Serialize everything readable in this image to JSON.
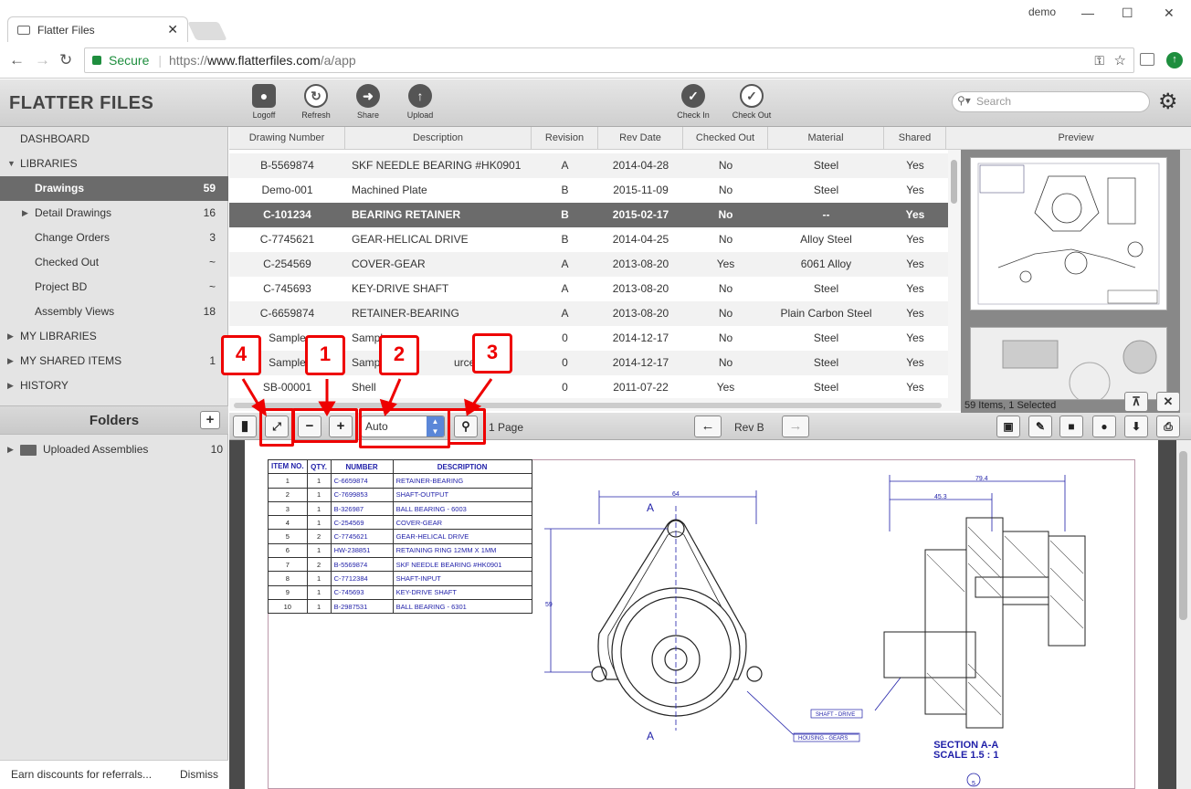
{
  "browser": {
    "tab_title": "Flatter Files",
    "tab_close": "✕",
    "user": "demo",
    "secure_label": "Secure",
    "url_prefix": "https://",
    "url_host": "www.flatterfiles.com",
    "url_path": "/a/app"
  },
  "app": {
    "brand": "FLATTER FILES",
    "toolbar": [
      {
        "label": "Logoff",
        "icon": "lock-icon"
      },
      {
        "label": "Refresh",
        "icon": "refresh-icon"
      },
      {
        "label": "Share",
        "icon": "share-arrow-icon"
      },
      {
        "label": "Upload",
        "icon": "upload-arrow-icon"
      },
      {
        "label": "Check In",
        "icon": "check-circle-filled-icon"
      },
      {
        "label": "Check Out",
        "icon": "check-circle-outline-icon"
      }
    ],
    "search_placeholder": "Search"
  },
  "sidebar": {
    "dashboard": "DASHBOARD",
    "libraries": "LIBRARIES",
    "items": [
      {
        "label": "Drawings",
        "count": "59"
      },
      {
        "label": "Detail Drawings",
        "count": "16"
      },
      {
        "label": "Change Orders",
        "count": "3"
      },
      {
        "label": "Checked Out",
        "count": "~"
      },
      {
        "label": "Project BD",
        "count": "~"
      },
      {
        "label": "Assembly Views",
        "count": "18"
      }
    ],
    "my_libraries": "MY LIBRARIES",
    "my_shared": "MY SHARED ITEMS",
    "my_shared_count": "1",
    "history": "HISTORY",
    "folders_title": "Folders",
    "folder_add": "+",
    "folder": "Uploaded Assemblies",
    "folder_count": "10",
    "footer_text": "Earn discounts for referrals...",
    "footer_dismiss": "Dismiss"
  },
  "table": {
    "columns": [
      "Drawing Number",
      "Description",
      "Revision",
      "Rev Date",
      "Checked Out",
      "Material",
      "Shared"
    ],
    "rows": [
      [
        "B-5569874",
        "SKF NEEDLE BEARING #HK0901",
        "A",
        "2014-04-28",
        "No",
        "Steel",
        "Yes"
      ],
      [
        "Demo-001",
        "Machined Plate",
        "B",
        "2015-11-09",
        "No",
        "Steel",
        "Yes"
      ],
      [
        "C-101234",
        "BEARING RETAINER",
        "B",
        "2015-02-17",
        "No",
        "--",
        "Yes"
      ],
      [
        "C-7745621",
        "GEAR-HELICAL DRIVE",
        "B",
        "2014-04-25",
        "No",
        "Alloy Steel",
        "Yes"
      ],
      [
        "C-254569",
        "COVER-GEAR",
        "A",
        "2013-08-20",
        "Yes",
        "6061 Alloy",
        "Yes"
      ],
      [
        "C-745693",
        "KEY-DRIVE SHAFT",
        "A",
        "2013-08-20",
        "No",
        "Steel",
        "Yes"
      ],
      [
        "C-6659874",
        "RETAINER-BEARING",
        "A",
        "2013-08-20",
        "No",
        "Plain Carbon Steel",
        "Yes"
      ],
      [
        "Sample",
        "Sample",
        "0",
        "2014-12-17",
        "No",
        "Steel",
        "Yes"
      ],
      [
        "Sample",
        "Sample",
        "0",
        "2014-12-17",
        "No",
        "Steel",
        "Yes"
      ],
      [
        "SB-00001",
        "Shell",
        "0",
        "2011-07-22",
        "Yes",
        "Steel",
        "Yes"
      ]
    ],
    "row8_desc_tail": "urce File"
  },
  "preview": {
    "title": "Preview",
    "count": "59 Items, 1 Selected"
  },
  "viewer": {
    "zoom": "Auto",
    "pages": "1 Page",
    "revision": "Rev B"
  },
  "annotations": [
    "4",
    "1",
    "2",
    "3"
  ],
  "drawing": {
    "bom_headers": [
      "ITEM NO.",
      "QTY.",
      "NUMBER",
      "DESCRIPTION"
    ],
    "bom": [
      [
        "1",
        "1",
        "C-6659874",
        "RETAINER-BEARING"
      ],
      [
        "2",
        "1",
        "C-7699853",
        "SHAFT-OUTPUT"
      ],
      [
        "3",
        "1",
        "B-326987",
        "BALL BEARING - 6003"
      ],
      [
        "4",
        "1",
        "C-254569",
        "COVER-GEAR"
      ],
      [
        "5",
        "2",
        "C-7745621",
        "GEAR-HELICAL DRIVE"
      ],
      [
        "6",
        "1",
        "HW-238851",
        "RETAINING RING 12MM  X 1MM"
      ],
      [
        "7",
        "2",
        "B-5569874",
        "SKF NEEDLE BEARING #HK0901"
      ],
      [
        "8",
        "1",
        "C-7712384",
        "SHAFT-INPUT"
      ],
      [
        "9",
        "1",
        "C-745693",
        "KEY-DRIVE SHAFT"
      ],
      [
        "10",
        "1",
        "B-2987531",
        "BALL BEARING - 6301"
      ]
    ],
    "dim_top": "64",
    "dim_side": "59",
    "dim_right_total": "79.4",
    "dim_right_part": "45.3",
    "section_mark": "A",
    "label_shaft": "SHAFT - DRIVE",
    "label_housing": "HOUSING - GEARS",
    "section_title": "SECTION A-A",
    "section_scale": "SCALE 1.5 : 1",
    "balloon": "5"
  },
  "colors": {
    "accent_red": "#e00000",
    "selected_row": "#6b6b6b",
    "drawing_blue": "#1f1fa8"
  }
}
